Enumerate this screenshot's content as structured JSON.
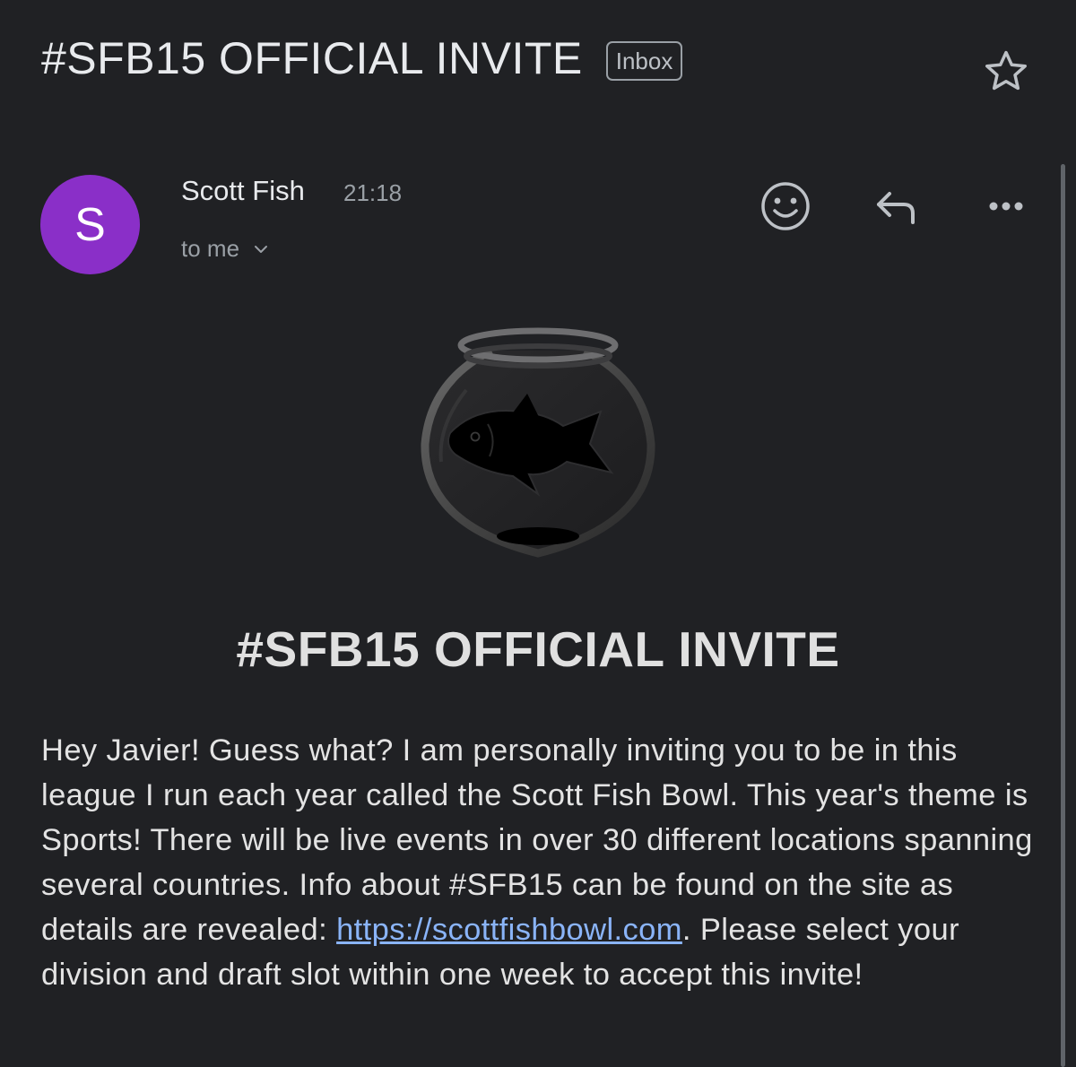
{
  "email": {
    "subject": "#SFB15 OFFICIAL INVITE",
    "label": "Inbox",
    "sender": {
      "initial": "S",
      "name": "Scott Fish",
      "time": "21:18",
      "recipients": "to me"
    },
    "body": {
      "headline": "#SFB15 OFFICIAL INVITE",
      "paragraph_before_link": "Hey Javier! Guess what? I am personally inviting you to be in this league I run each year called the Scott Fish Bowl. This year's theme is Sports! There will be live events in over 30 different locations spanning several countries. Info about #SFB15 can be found on the site as details are revealed: ",
      "link_text": "https://scottfishbowl.com",
      "paragraph_after_link": ". Please select your division and draft slot within one week to accept this invite!"
    }
  },
  "icons": {
    "star": "star-icon",
    "emoji": "add-reaction-icon",
    "reply": "reply-icon",
    "more": "more-icon",
    "expand": "chevron-down-icon",
    "logo": "fishbowl-logo"
  },
  "colors": {
    "background": "#202124",
    "avatar": "#8a2fc8",
    "link": "#8ab4f8"
  }
}
